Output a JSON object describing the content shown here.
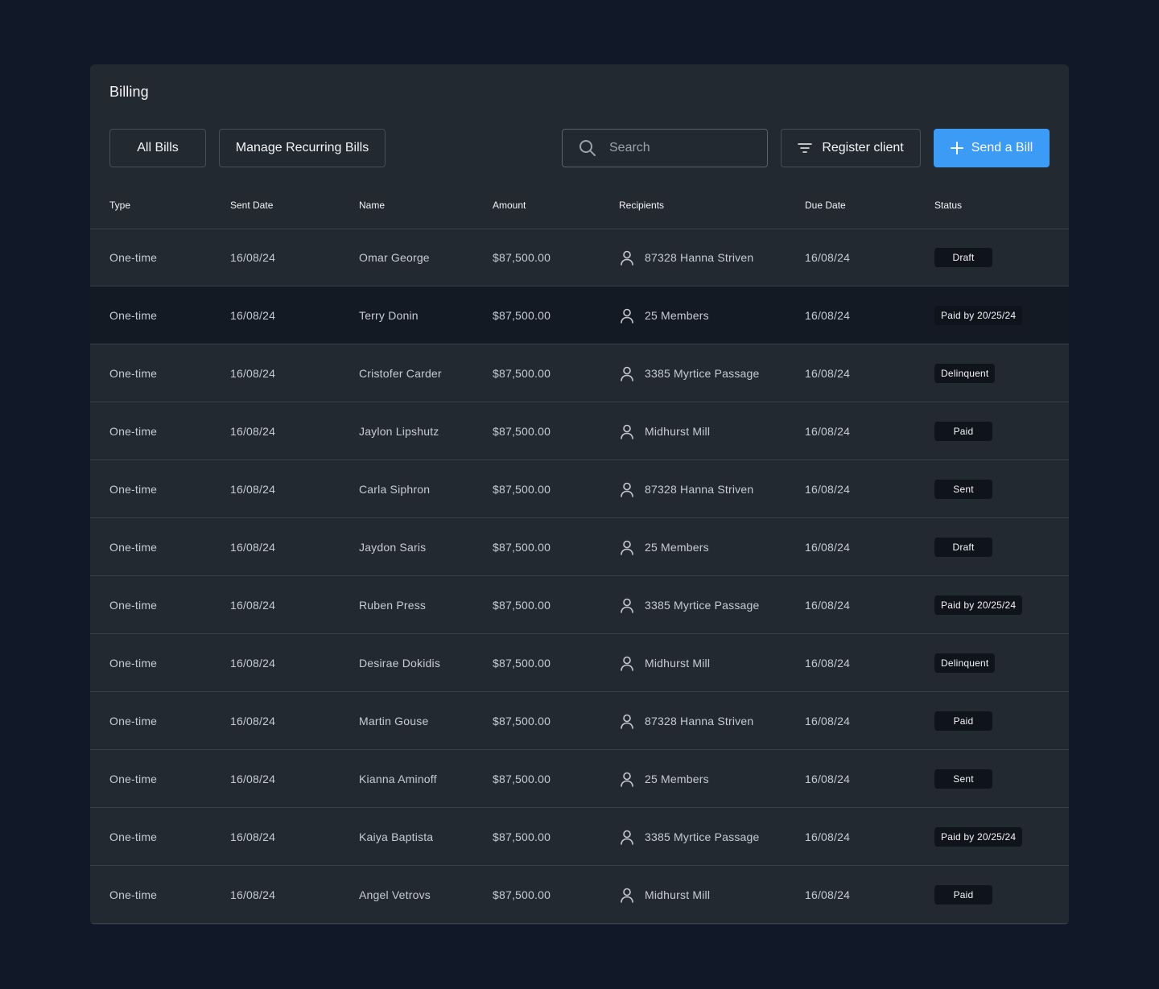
{
  "page": {
    "title": "Billing"
  },
  "toolbar": {
    "all_bills": "All Bills",
    "manage_recurring": "Manage Recurring Bills",
    "search_placeholder": "Search",
    "register_client": "Register client",
    "send_bill": "Send a Bill"
  },
  "icons": {
    "search": "search-icon",
    "filter": "filter-icon",
    "plus": "plus-icon",
    "user": "user-icon"
  },
  "colors": {
    "background": "#111827",
    "card": "#222931",
    "accent": "#3b9bf5",
    "badge": "#0f141c",
    "highlight_row": "#131a24"
  },
  "table": {
    "headers": {
      "type": "Type",
      "sent_date": "Sent Date",
      "name": "Name",
      "amount": "Amount",
      "recipients": "Recipients",
      "due_date": "Due Date",
      "status": "Status"
    },
    "rows": [
      {
        "type": "One-time",
        "sent": "16/08/24",
        "name": "Omar George",
        "amount": "$87,500.00",
        "recipients": "87328 Hanna Striven",
        "due": "16/08/24",
        "status": "Draft"
      },
      {
        "type": "One-time",
        "sent": "16/08/24",
        "name": "Terry Donin",
        "amount": "$87,500.00",
        "recipients": "25 Members",
        "due": "16/08/24",
        "status": "Paid by 20/25/24"
      },
      {
        "type": "One-time",
        "sent": "16/08/24",
        "name": "Cristofer Carder",
        "amount": "$87,500.00",
        "recipients": "3385 Myrtice Passage",
        "due": "16/08/24",
        "status": "Delinquent"
      },
      {
        "type": "One-time",
        "sent": "16/08/24",
        "name": "Jaylon Lipshutz",
        "amount": "$87,500.00",
        "recipients": "Midhurst Mill",
        "due": "16/08/24",
        "status": "Paid"
      },
      {
        "type": "One-time",
        "sent": "16/08/24",
        "name": "Carla Siphron",
        "amount": "$87,500.00",
        "recipients": "87328 Hanna Striven",
        "due": "16/08/24",
        "status": "Sent"
      },
      {
        "type": "One-time",
        "sent": "16/08/24",
        "name": "Jaydon Saris",
        "amount": "$87,500.00",
        "recipients": "25 Members",
        "due": "16/08/24",
        "status": "Draft"
      },
      {
        "type": "One-time",
        "sent": "16/08/24",
        "name": "Ruben Press",
        "amount": "$87,500.00",
        "recipients": "3385 Myrtice Passage",
        "due": "16/08/24",
        "status": "Paid by 20/25/24"
      },
      {
        "type": "One-time",
        "sent": "16/08/24",
        "name": "Desirae Dokidis",
        "amount": "$87,500.00",
        "recipients": "Midhurst Mill",
        "due": "16/08/24",
        "status": "Delinquent"
      },
      {
        "type": "One-time",
        "sent": "16/08/24",
        "name": "Martin Gouse",
        "amount": "$87,500.00",
        "recipients": "87328 Hanna Striven",
        "due": "16/08/24",
        "status": "Paid"
      },
      {
        "type": "One-time",
        "sent": "16/08/24",
        "name": "Kianna Aminoff",
        "amount": "$87,500.00",
        "recipients": "25 Members",
        "due": "16/08/24",
        "status": "Sent"
      },
      {
        "type": "One-time",
        "sent": "16/08/24",
        "name": "Kaiya Baptista",
        "amount": "$87,500.00",
        "recipients": "3385 Myrtice Passage",
        "due": "16/08/24",
        "status": "Paid by 20/25/24"
      },
      {
        "type": "One-time",
        "sent": "16/08/24",
        "name": "Angel Vetrovs",
        "amount": "$87,500.00",
        "recipients": "Midhurst Mill",
        "due": "16/08/24",
        "status": "Paid"
      }
    ],
    "highlighted_row_index": 1
  }
}
